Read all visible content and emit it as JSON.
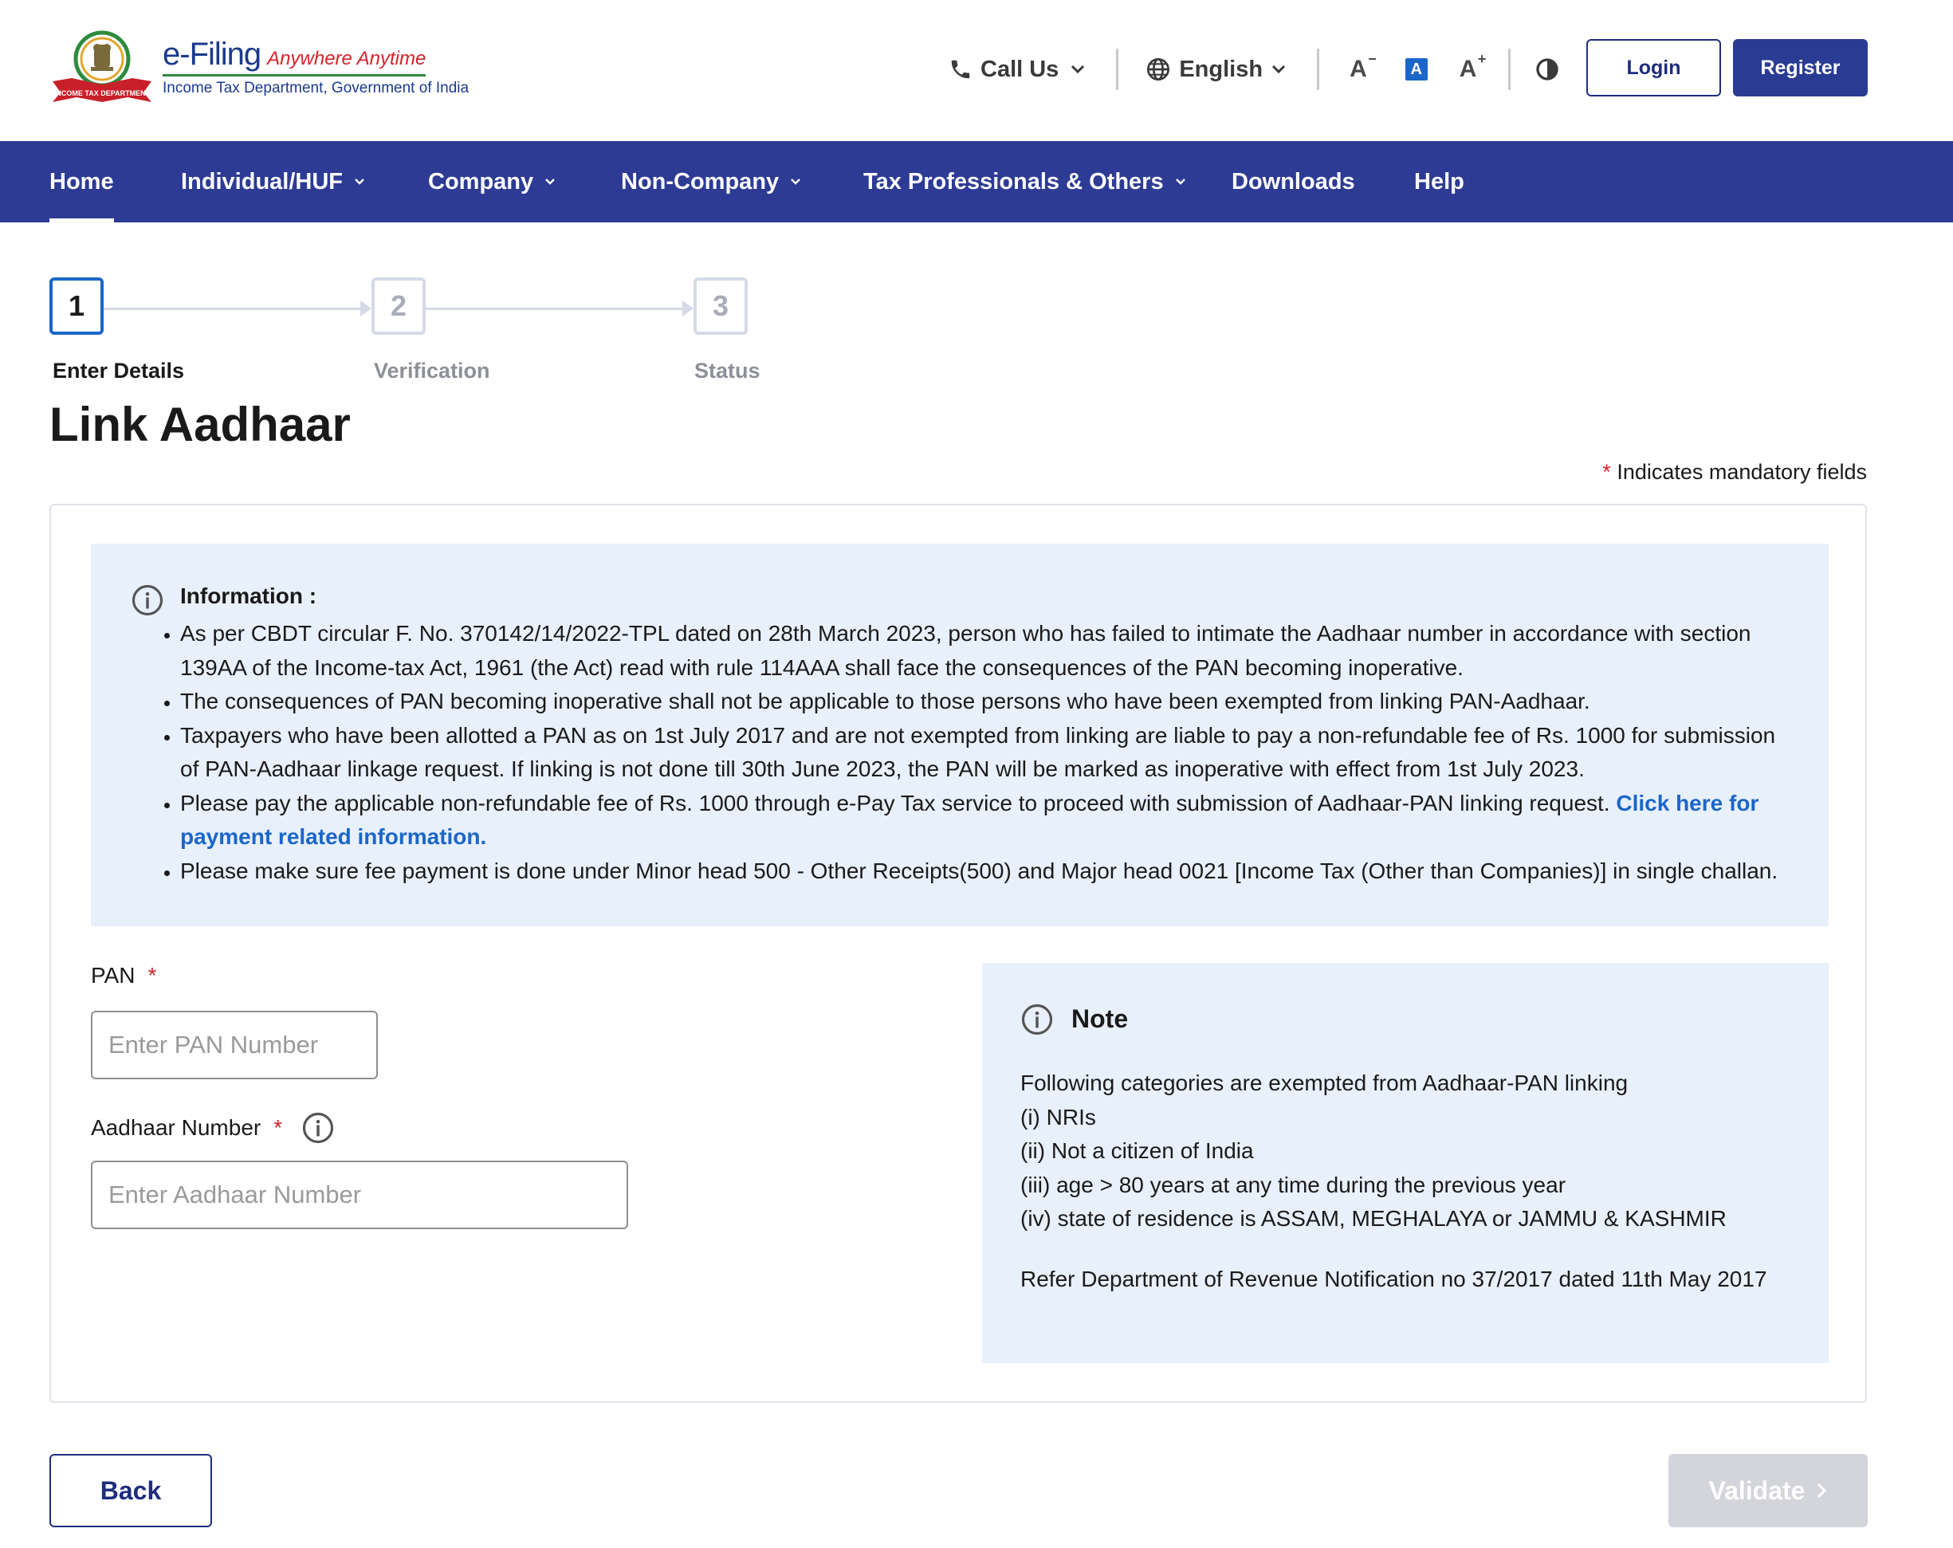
{
  "header": {
    "brand_name": "e-Filing",
    "brand_tagline": "Anywhere Anytime",
    "brand_subtitle": "Income Tax Department, Government of India",
    "emblem_text": "INCOME TAX DEPARTMENT",
    "call_us": "Call Us",
    "language": "English",
    "font_small": "A",
    "font_normal": "A",
    "font_large": "A",
    "login_label": "Login",
    "register_label": "Register"
  },
  "nav": {
    "items": [
      {
        "label": "Home",
        "active": true
      },
      {
        "label": "Individual/HUF",
        "dropdown": true
      },
      {
        "label": "Company",
        "dropdown": true
      },
      {
        "label": "Non-Company",
        "dropdown": true
      },
      {
        "label": "Tax Professionals & Others",
        "dropdown": true
      },
      {
        "label": "Downloads"
      },
      {
        "label": "Help"
      }
    ]
  },
  "stepper": {
    "steps": [
      {
        "number": "1",
        "label": "Enter Details",
        "state": "active"
      },
      {
        "number": "2",
        "label": "Verification",
        "state": "inactive"
      },
      {
        "number": "3",
        "label": "Status",
        "state": "inactive"
      }
    ]
  },
  "page": {
    "title": "Link Aadhaar",
    "mandatory_star": "*",
    "mandatory_text": "Indicates mandatory fields"
  },
  "information": {
    "title": "Information :",
    "bullets": [
      "As per CBDT circular F. No. 370142/14/2022-TPL dated on 28th March 2023, person who has failed to intimate the Aadhaar number in accordance with section 139AA of the Income-tax Act, 1961 (the Act) read with rule 114AAA shall face the consequences of the PAN becoming inoperative.",
      "The consequences of PAN becoming inoperative shall not be applicable to those persons who have been exempted from linking PAN-Aadhaar.",
      "Taxpayers who have been allotted a PAN as on 1st July 2017 and are not exempted from linking are liable to pay a non-refundable fee of Rs. 1000 for submission of PAN-Aadhaar linkage request. If linking is not done till 30th June 2023, the PAN will be marked as inoperative with effect from 1st July 2023.",
      "Please pay the applicable non-refundable fee of Rs. 1000 through e-Pay Tax service to proceed with submission of Aadhaar-PAN linking request.",
      "Please make sure fee payment is done under Minor head 500 - Other Receipts(500) and Major head 0021 [Income Tax (Other than Companies)] in single challan."
    ],
    "payment_link": "Click here for payment related information."
  },
  "form": {
    "pan_label": "PAN",
    "pan_placeholder": "Enter PAN Number",
    "pan_value": "",
    "aadhaar_label": "Aadhaar Number",
    "aadhaar_placeholder": "Enter Aadhaar Number",
    "aadhaar_value": "",
    "required_mark": "*"
  },
  "note": {
    "title": "Note",
    "lines": [
      "Following categories are exempted from Aadhaar-PAN linking",
      "(i) NRIs",
      "(ii) Not a citizen of India",
      "(iii) age > 80 years at any time during the previous year",
      "(iv) state of residence is ASSAM, MEGHALAYA or JAMMU & KASHMIR"
    ],
    "reference": "Refer Department of Revenue Notification no 37/2017 dated 11th May 2017"
  },
  "actions": {
    "back_label": "Back",
    "validate_label": "Validate",
    "validate_enabled": false
  },
  "colors": {
    "nav_bg": "#2d3b94",
    "primary": "#293b92",
    "accent_blue": "#1b66c9",
    "info_bg": "#e8f0fb",
    "required_red": "#d3232a",
    "disabled_btn": "#d3d5da"
  },
  "icons": {
    "phone": "phone-icon",
    "language": "globe-icon",
    "contrast": "contrast-icon",
    "info": "info-icon",
    "chevron": "chevron-down-icon",
    "next": "chevron-right-icon"
  }
}
